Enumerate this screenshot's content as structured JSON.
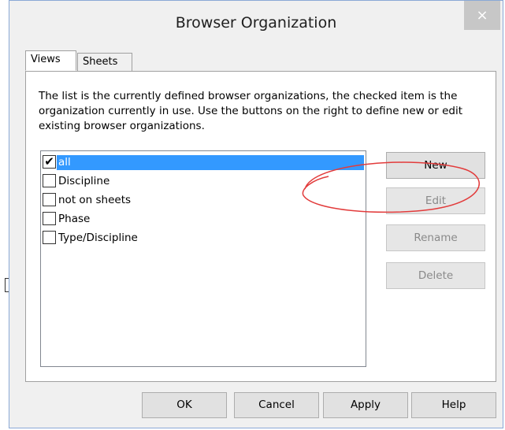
{
  "window": {
    "title": "Browser Organization",
    "close_label": "×"
  },
  "tabs": [
    {
      "label": "Views"
    },
    {
      "label": "Sheets"
    }
  ],
  "description": "The list is the currently defined browser organizations,  the checked item is the organization currently in use. Use the buttons on the right to define new or edit existing browser organizations.",
  "list": {
    "items": [
      {
        "label": "all",
        "checked": true,
        "selected": true
      },
      {
        "label": "Discipline",
        "checked": false,
        "selected": false
      },
      {
        "label": "not on sheets",
        "checked": false,
        "selected": false
      },
      {
        "label": "Phase",
        "checked": false,
        "selected": false
      },
      {
        "label": "Type/Discipline",
        "checked": false,
        "selected": false
      }
    ],
    "check_glyph": "✔"
  },
  "side_buttons": {
    "new": "New",
    "edit": "Edit",
    "rename": "Rename",
    "delete": "Delete"
  },
  "bottom_buttons": {
    "ok": "OK",
    "cancel": "Cancel",
    "apply": "Apply",
    "help": "Help"
  },
  "colors": {
    "selection": "#3399ff",
    "annotation": "#e23b3b"
  }
}
